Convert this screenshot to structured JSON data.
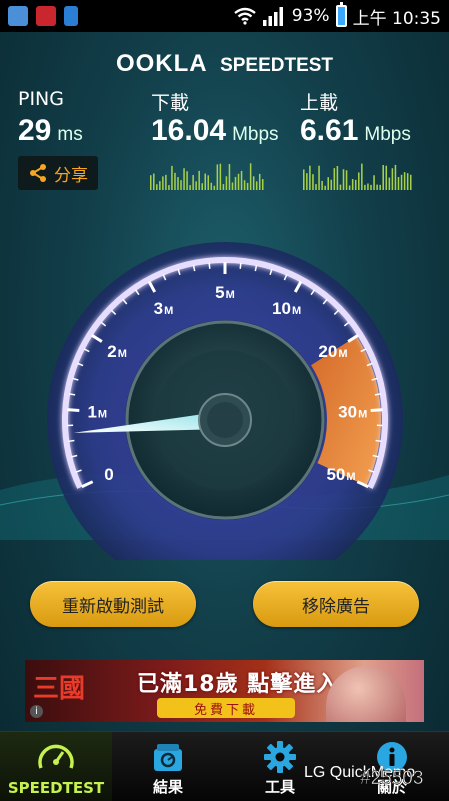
{
  "status_bar": {
    "battery": "93%",
    "time": "上午 10:35"
  },
  "header": {
    "brand": "OOKLA",
    "product": "SPEEDTEST"
  },
  "metrics": {
    "ping": {
      "label": "PING",
      "value": "29",
      "unit": "ms"
    },
    "download": {
      "label": "下載",
      "value": "16.04",
      "unit": "Mbps"
    },
    "upload": {
      "label": "上載",
      "value": "6.61",
      "unit": "Mbps"
    }
  },
  "share": {
    "label": "分享"
  },
  "gauge": {
    "ticks": [
      "0",
      "1",
      "2",
      "3",
      "5",
      "10",
      "20",
      "30",
      "50"
    ],
    "tick_unit": "M",
    "needle_value_mbps": 0.7
  },
  "buttons": {
    "restart": "重新啟動測試",
    "remove_ads": "移除廣告"
  },
  "ad": {
    "title": "已滿18歲 點擊進入",
    "cta": "免費下載"
  },
  "tabs": [
    {
      "label": "SPEEDTEST",
      "icon": "speedometer-icon"
    },
    {
      "label": "結果",
      "icon": "results-icon"
    },
    {
      "label": "工具",
      "icon": "gear-icon"
    },
    {
      "label": "關於",
      "icon": "info-icon"
    }
  ],
  "overlay_text": "LG QuickMemo",
  "watermark": "#25503",
  "colors": {
    "accent": "#c6f24f",
    "button": "#f2b726",
    "gauge_ring": "#b9a3ff",
    "gauge_hot": "#f08a3a"
  }
}
